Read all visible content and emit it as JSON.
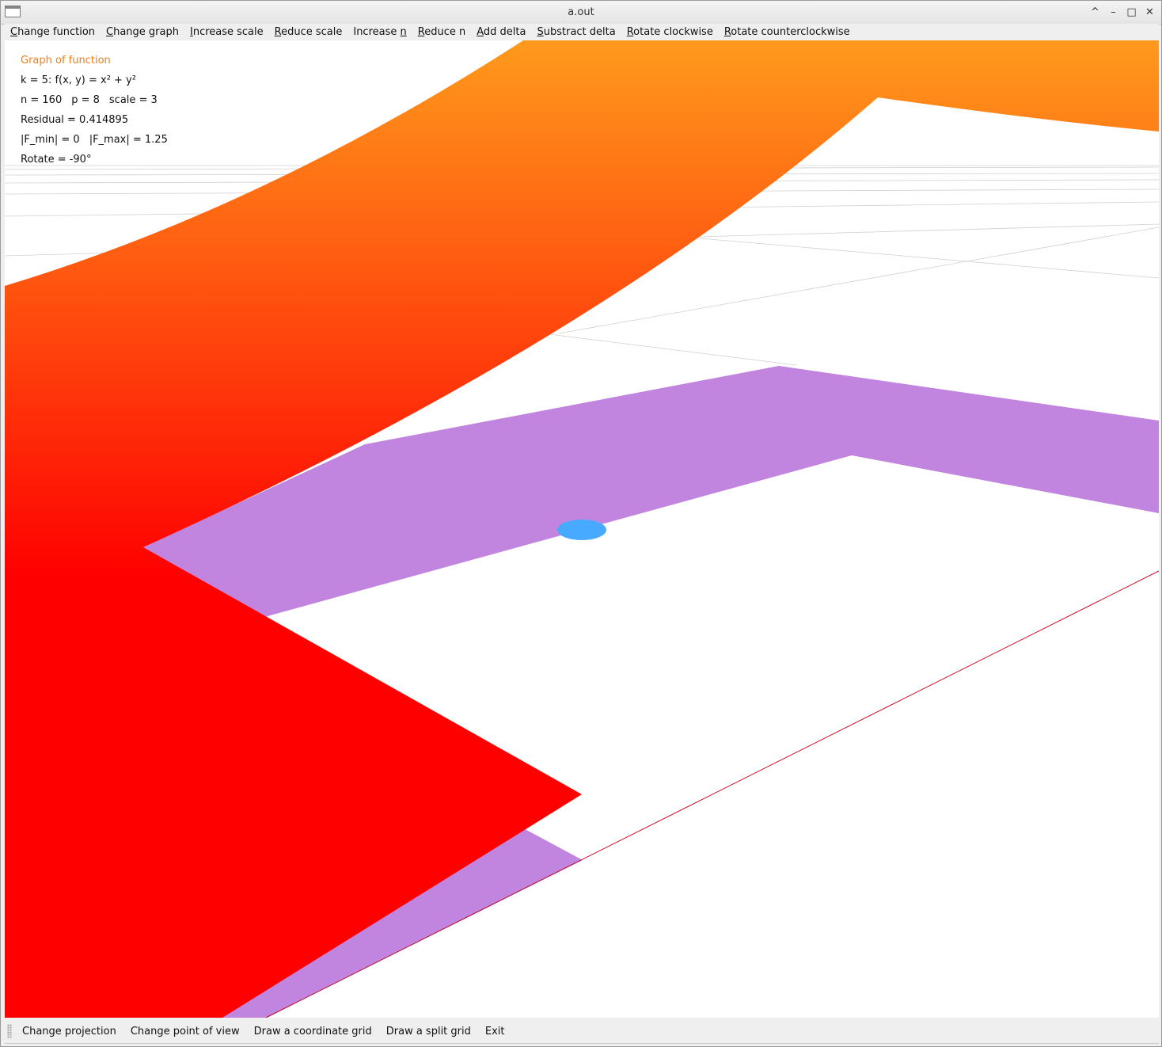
{
  "window": {
    "title": "a.out",
    "controls": {
      "shade": "^",
      "minimize": "–",
      "maximize": "□",
      "close": "✕"
    }
  },
  "menu": [
    {
      "pre": "",
      "acc": "C",
      "post": "hange function"
    },
    {
      "pre": "",
      "acc": "C",
      "post": "hange graph"
    },
    {
      "pre": "",
      "acc": "I",
      "post": "ncrease scale"
    },
    {
      "pre": "",
      "acc": "R",
      "post": "educe scale"
    },
    {
      "pre": "Increase ",
      "acc": "n",
      "post": ""
    },
    {
      "pre": "",
      "acc": "R",
      "post": "educe n"
    },
    {
      "pre": "",
      "acc": "A",
      "post": "dd delta"
    },
    {
      "pre": "",
      "acc": "S",
      "post": "ubstract delta"
    },
    {
      "pre": "",
      "acc": "R",
      "post": "otate clockwise"
    },
    {
      "pre": "",
      "acc": "R",
      "post": "otate counterclockwise"
    }
  ],
  "info": {
    "heading": "Graph of function",
    "function": "k = 5: f(x, y) = x² + y²",
    "n": "n = 160",
    "p": "p = 8",
    "scale": "scale = 3",
    "residual": "Residual = 0.414895",
    "fmin": "|F_min| = 0",
    "fmax": "|F_max| = 1.25",
    "rotate": "Rotate = -90°"
  },
  "toolbar": {
    "change_projection": "Change projection",
    "change_point_of_view": "Change point of view",
    "draw_coordinate_grid": "Draw a coordinate grid",
    "draw_split_grid": "Draw a split grid",
    "exit": "Exit"
  },
  "colors": {
    "surface_top": "#ff9a1c",
    "surface_bottom": "#ff0000",
    "residual_band": "#c184df",
    "marker": "#48aaff",
    "axis_line": "#c00020",
    "grid_lines": "#d0d0d0",
    "heading_text": "#ef7f1a"
  }
}
